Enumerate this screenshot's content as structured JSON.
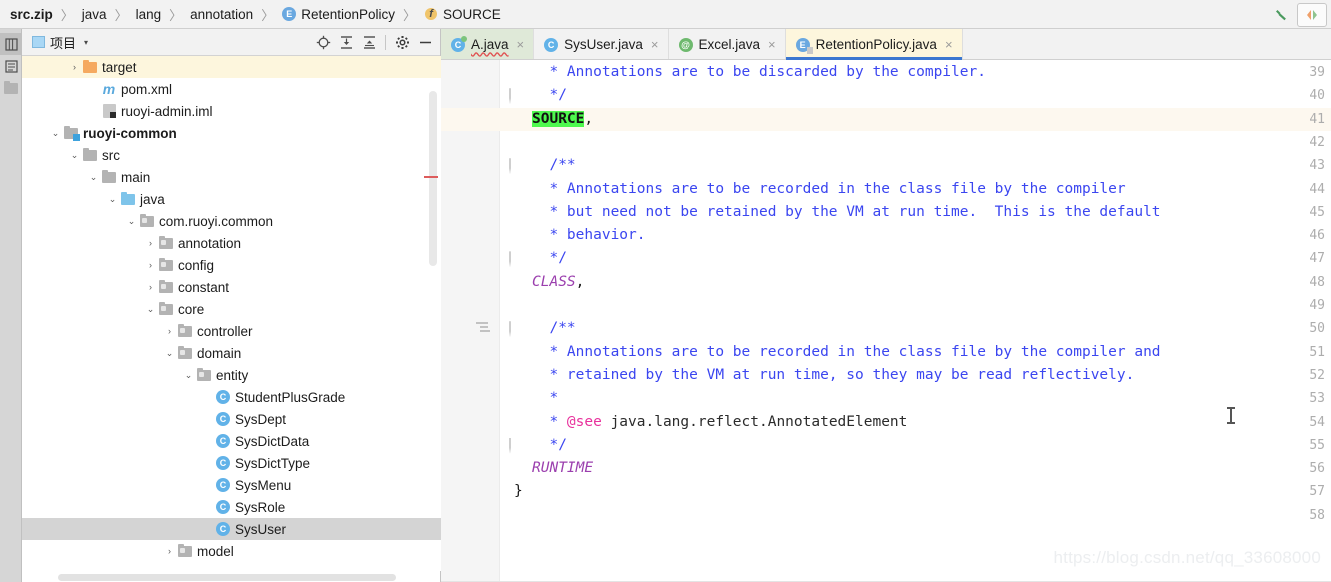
{
  "breadcrumb": {
    "items": [
      {
        "label": "src.zip",
        "icon": "none",
        "bold": true
      },
      {
        "label": "java",
        "icon": "none",
        "bold": false
      },
      {
        "label": "lang",
        "icon": "none",
        "bold": false
      },
      {
        "label": "annotation",
        "icon": "none",
        "bold": false
      },
      {
        "label": "RetentionPolicy",
        "icon": "enum-icon",
        "bold": false
      },
      {
        "label": "SOURCE",
        "icon": "field-icon",
        "bold": false
      }
    ],
    "separator": "〉"
  },
  "top_toolbar": {
    "build_label": "hammer-icon",
    "run_label": "colored-icon"
  },
  "left_strip": {
    "items": [
      {
        "label": "项目",
        "name": "project"
      },
      {
        "label": "结构",
        "name": "structure"
      }
    ]
  },
  "project_panel": {
    "title": "项目",
    "dropdown_caret": "▾",
    "tools": [
      {
        "name": "locate-icon",
        "label": "Select Opened File"
      },
      {
        "name": "expand-all-icon",
        "label": "Expand All"
      },
      {
        "name": "collapse-all-icon",
        "label": "Collapse All"
      },
      {
        "name": "settings-gear-icon",
        "label": "Settings"
      },
      {
        "name": "hide-icon",
        "label": "Hide"
      }
    ],
    "tree": [
      {
        "label": "target",
        "indent": 2,
        "arrow": "›",
        "icon": "folder-orange",
        "state": "cream",
        "bold": false
      },
      {
        "label": "pom.xml",
        "indent": 3,
        "arrow": "",
        "icon": "maven",
        "state": "",
        "bold": false
      },
      {
        "label": "ruoyi-admin.iml",
        "indent": 3,
        "arrow": "",
        "icon": "iml",
        "state": "",
        "bold": false
      },
      {
        "label": "ruoyi-common",
        "indent": 1,
        "arrow": "⌄",
        "icon": "folder-module",
        "state": "",
        "bold": true
      },
      {
        "label": "src",
        "indent": 2,
        "arrow": "⌄",
        "icon": "folder-gray",
        "state": "",
        "bold": false
      },
      {
        "label": "main",
        "indent": 3,
        "arrow": "⌄",
        "icon": "folder-gray",
        "state": "",
        "bold": false
      },
      {
        "label": "java",
        "indent": 4,
        "arrow": "⌄",
        "icon": "folder-blue",
        "state": "",
        "bold": false
      },
      {
        "label": "com.ruoyi.common",
        "indent": 5,
        "arrow": "⌄",
        "icon": "package",
        "state": "",
        "bold": false
      },
      {
        "label": "annotation",
        "indent": 6,
        "arrow": "›",
        "icon": "package",
        "state": "",
        "bold": false
      },
      {
        "label": "config",
        "indent": 6,
        "arrow": "›",
        "icon": "package",
        "state": "",
        "bold": false
      },
      {
        "label": "constant",
        "indent": 6,
        "arrow": "›",
        "icon": "package",
        "state": "",
        "bold": false
      },
      {
        "label": "core",
        "indent": 6,
        "arrow": "⌄",
        "icon": "package",
        "state": "",
        "bold": false
      },
      {
        "label": "controller",
        "indent": 7,
        "arrow": "›",
        "icon": "package",
        "state": "",
        "bold": false
      },
      {
        "label": "domain",
        "indent": 7,
        "arrow": "⌄",
        "icon": "package",
        "state": "",
        "bold": false
      },
      {
        "label": "entity",
        "indent": 8,
        "arrow": "⌄",
        "icon": "package",
        "state": "",
        "bold": false
      },
      {
        "label": "StudentPlusGrade",
        "indent": 9,
        "arrow": "",
        "icon": "class",
        "state": "",
        "bold": false
      },
      {
        "label": "SysDept",
        "indent": 9,
        "arrow": "",
        "icon": "class",
        "state": "",
        "bold": false
      },
      {
        "label": "SysDictData",
        "indent": 9,
        "arrow": "",
        "icon": "class",
        "state": "",
        "bold": false
      },
      {
        "label": "SysDictType",
        "indent": 9,
        "arrow": "",
        "icon": "class",
        "state": "",
        "bold": false
      },
      {
        "label": "SysMenu",
        "indent": 9,
        "arrow": "",
        "icon": "class",
        "state": "",
        "bold": false
      },
      {
        "label": "SysRole",
        "indent": 9,
        "arrow": "",
        "icon": "class",
        "state": "",
        "bold": false
      },
      {
        "label": "SysUser",
        "indent": 9,
        "arrow": "",
        "icon": "class",
        "state": "gray",
        "bold": false
      },
      {
        "label": "model",
        "indent": 7,
        "arrow": "›",
        "icon": "package",
        "state": "",
        "bold": false
      }
    ]
  },
  "editor": {
    "tabs": [
      {
        "label": "A.java",
        "icon": "class-modified-icon",
        "style": "green",
        "close": "×",
        "error": true
      },
      {
        "label": "SysUser.java",
        "icon": "class-icon",
        "style": "plain",
        "close": "×",
        "error": false
      },
      {
        "label": "Excel.java",
        "icon": "annotation-icon",
        "style": "plain",
        "close": "×",
        "error": false
      },
      {
        "label": "RetentionPolicy.java",
        "icon": "enum-icon",
        "style": "active",
        "close": "×",
        "error": false
      }
    ],
    "first_line_number": 39,
    "caret_line": 41,
    "lines": [
      {
        "n": 39,
        "fold": false,
        "mark": false,
        "tokens": [
          {
            "t": "  * Annotations are to be discarded by the compiler.",
            "c": "cmt"
          }
        ]
      },
      {
        "n": 40,
        "fold": true,
        "mark": false,
        "tokens": [
          {
            "t": "  */",
            "c": "cmt"
          }
        ]
      },
      {
        "n": 41,
        "fold": false,
        "mark": false,
        "tokens": [
          {
            "t": "SOURCE",
            "c": "hl-green"
          },
          {
            "t": ",",
            "c": "punct"
          }
        ]
      },
      {
        "n": 42,
        "fold": false,
        "mark": false,
        "tokens": []
      },
      {
        "n": 43,
        "fold": true,
        "mark": false,
        "tokens": [
          {
            "t": "  /**",
            "c": "cmt"
          }
        ]
      },
      {
        "n": 44,
        "fold": false,
        "mark": false,
        "tokens": [
          {
            "t": "  * Annotations are to be recorded in the class file by the compiler",
            "c": "cmt"
          }
        ]
      },
      {
        "n": 45,
        "fold": false,
        "mark": false,
        "tokens": [
          {
            "t": "  * but need not be retained by the VM at run time.  This is the default",
            "c": "cmt"
          }
        ]
      },
      {
        "n": 46,
        "fold": false,
        "mark": false,
        "tokens": [
          {
            "t": "  * behavior.",
            "c": "cmt"
          }
        ]
      },
      {
        "n": 47,
        "fold": true,
        "mark": false,
        "tokens": [
          {
            "t": "  */",
            "c": "cmt"
          }
        ]
      },
      {
        "n": 48,
        "fold": false,
        "mark": false,
        "tokens": [
          {
            "t": "CLASS",
            "c": "const"
          },
          {
            "t": ",",
            "c": "punct"
          }
        ]
      },
      {
        "n": 49,
        "fold": false,
        "mark": false,
        "tokens": []
      },
      {
        "n": 50,
        "fold": true,
        "mark": true,
        "tokens": [
          {
            "t": "  /**",
            "c": "cmt"
          }
        ]
      },
      {
        "n": 51,
        "fold": false,
        "mark": false,
        "tokens": [
          {
            "t": "  * Annotations are to be recorded in the class file by the compiler and",
            "c": "cmt"
          }
        ]
      },
      {
        "n": 52,
        "fold": false,
        "mark": false,
        "tokens": [
          {
            "t": "  * retained by the VM at run time, so they may be read reflectively.",
            "c": "cmt"
          }
        ]
      },
      {
        "n": 53,
        "fold": false,
        "mark": false,
        "tokens": [
          {
            "t": "  *",
            "c": "cmt"
          }
        ]
      },
      {
        "n": 54,
        "fold": false,
        "mark": false,
        "tokens": [
          {
            "t": "  * ",
            "c": "cmt"
          },
          {
            "t": "@see",
            "c": "tag"
          },
          {
            "t": " java.lang.reflect.AnnotatedElement",
            "c": "plain-txt"
          }
        ]
      },
      {
        "n": 55,
        "fold": true,
        "mark": false,
        "tokens": [
          {
            "t": "  */",
            "c": "cmt"
          }
        ]
      },
      {
        "n": 56,
        "fold": false,
        "mark": false,
        "tokens": [
          {
            "t": "RUNTIME",
            "c": "const"
          }
        ]
      },
      {
        "n": 57,
        "fold": false,
        "mark": false,
        "tokens": [
          {
            "t": "}",
            "c": "punct"
          },
          {
            "t": "",
            "c": "punct"
          }
        ],
        "unindent": true
      },
      {
        "n": 58,
        "fold": false,
        "mark": false,
        "tokens": []
      }
    ],
    "watermark": "https://blog.csdn.net/qq_33608000"
  },
  "colors": {
    "comment_blue": "#3b46f0",
    "tag_pink": "#e8319c",
    "constant_purple": "#9b3fae",
    "highlight_green": "#4ef84e",
    "active_tab_underline": "#3c77d0",
    "caret_line": "#fdf8ef"
  }
}
